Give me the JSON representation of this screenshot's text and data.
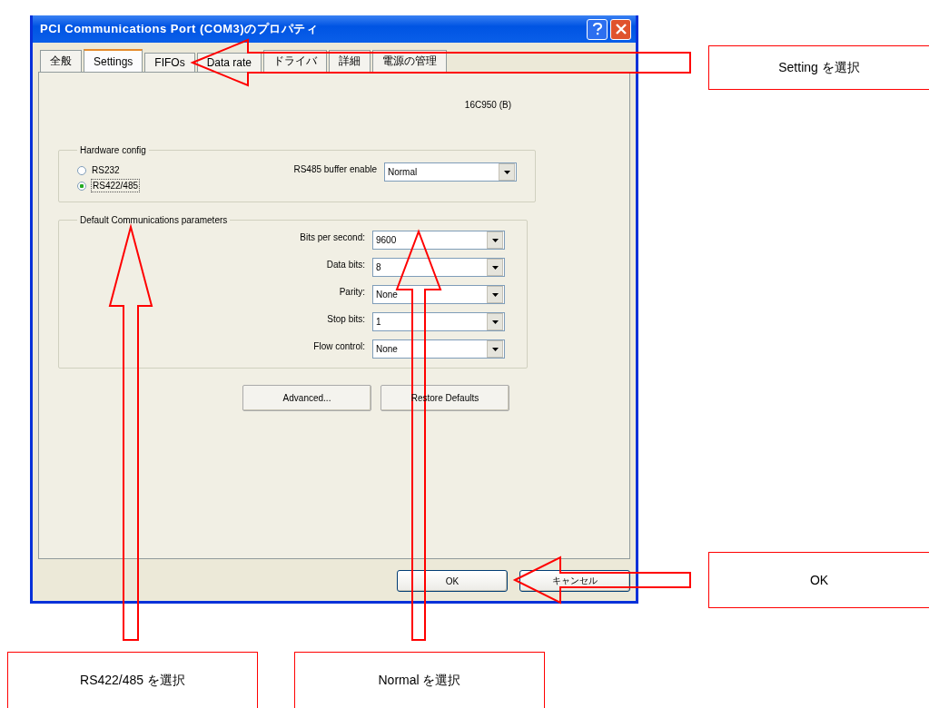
{
  "window": {
    "title": "PCI Communications Port (COM3)のプロパティ"
  },
  "tabs": [
    {
      "label": "全般",
      "selected": false
    },
    {
      "label": "Settings",
      "selected": true
    },
    {
      "label": "FIFOs",
      "selected": false
    },
    {
      "label": "Data rate",
      "selected": false
    },
    {
      "label": "ドライバ",
      "selected": false
    },
    {
      "label": "詳細",
      "selected": false
    },
    {
      "label": "電源の管理",
      "selected": false
    }
  ],
  "chip": "16C950 (B)",
  "hardware_config": {
    "title": "Hardware config",
    "radios": [
      {
        "label": "RS232",
        "selected": false
      },
      {
        "label": "RS422/485",
        "selected": true
      }
    ],
    "buffer_label": "RS485 buffer enable",
    "buffer_value": "Normal"
  },
  "parameters": {
    "title": "Default Communications parameters",
    "fields": [
      {
        "label": "Bits per second:",
        "value": "9600"
      },
      {
        "label": "Data bits:",
        "value": "8"
      },
      {
        "label": "Parity:",
        "value": "None"
      },
      {
        "label": "Stop bits:",
        "value": "1"
      },
      {
        "label": "Flow control:",
        "value": "None"
      }
    ],
    "buttons": [
      "Advanced...",
      "Restore Defaults"
    ]
  },
  "footer_buttons": [
    "OK",
    "キャンセル"
  ],
  "annotations": [
    "Setting を選択",
    "OK",
    "RS422/485 を選択",
    "Normal を選択"
  ]
}
